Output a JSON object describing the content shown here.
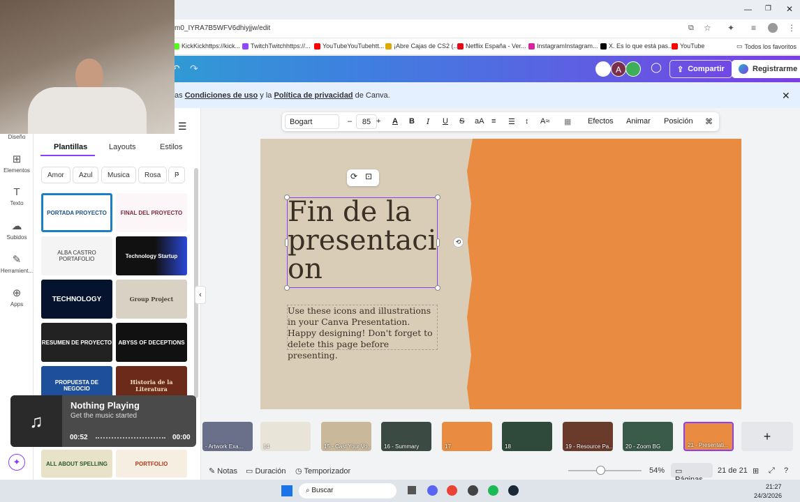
{
  "browser": {
    "url": "m0_IYRA7B5WFV6dhiyjjw/edit",
    "bookmarks": [
      {
        "label": "KickKickhttps://kick...",
        "color": "#53fc18"
      },
      {
        "label": "TwitchTwitchhttps://...",
        "color": "#9146ff"
      },
      {
        "label": "YouTubeYouTubehtt...",
        "color": "#ff0000"
      },
      {
        "label": "¡Abre Cajas de CS2 (...",
        "color": "#e0a800"
      },
      {
        "label": "Netflix España - Ver...",
        "color": "#e50914"
      },
      {
        "label": "InstagramInstagram...",
        "color": "#d6249f"
      },
      {
        "label": "X. Es lo que está pas...",
        "color": "#000000"
      },
      {
        "label": "YouTube",
        "color": "#ff0000"
      }
    ],
    "all_favorites": "Todos los favoritos"
  },
  "header": {
    "avatar_letter": "A",
    "share_label": "Compartir",
    "register_label": "Registrarme"
  },
  "notice": {
    "prefix": "as ",
    "terms": "Condiciones de uso",
    "middle": " y la ",
    "privacy": "Política de privacidad",
    "suffix": " de Canva."
  },
  "rail": [
    {
      "label": "Diseño",
      "icon": "design-icon"
    },
    {
      "label": "Elementos",
      "icon": "elements-icon"
    },
    {
      "label": "Texto",
      "icon": "text-icon"
    },
    {
      "label": "Subidos",
      "icon": "upload-icon"
    },
    {
      "label": "Herramient...",
      "icon": "tools-icon"
    },
    {
      "label": "Apps",
      "icon": "apps-icon"
    }
  ],
  "panel": {
    "tabs": [
      "Plantillas",
      "Layouts",
      "Estilos"
    ],
    "chips": [
      "Amor",
      "Azul",
      "Musica",
      "Rosa",
      "F"
    ],
    "templates": [
      {
        "text": "PORTADA PROYECTO"
      },
      {
        "text": "FINAL DEL PROYECTO"
      },
      {
        "text": "ALBA CASTRO PORTAFOLIO"
      },
      {
        "text": "Technology Startup"
      },
      {
        "text": "TECHNOLOGY"
      },
      {
        "text": "Group Project"
      },
      {
        "text": "RESUMEN DE PROYECTO"
      },
      {
        "text": "ABYSS OF DECEPTIONS"
      },
      {
        "text": "PROPUESTA DE NEGOCIO"
      },
      {
        "text": "Historia de la Literatura"
      },
      {
        "text": "ALL ABOUT SPELLING"
      },
      {
        "text": "PORTFOLIO"
      }
    ]
  },
  "toolbar": {
    "font": "Bogart",
    "size": "85",
    "effects": "Efectos",
    "animate": "Animar",
    "position": "Posición"
  },
  "slide": {
    "title": "Fin de la presentaci on",
    "body": "Use these icons and illustrations in your Canva Presentation. Happy designing! Don't forget to delete this page before presenting."
  },
  "music": {
    "title": "Nothing Playing",
    "subtitle": "Get the music started",
    "elapsed": "00:52",
    "remaining": "00:00"
  },
  "pages": [
    {
      "label": "- Artwork Exa..."
    },
    {
      "label": "14"
    },
    {
      "label": "15 - Cast Your Vo..."
    },
    {
      "label": "16 - Summary"
    },
    {
      "label": "17"
    },
    {
      "label": "18"
    },
    {
      "label": "19 - Resource Pa..."
    },
    {
      "label": "20 - Zoom BG"
    },
    {
      "label": "21 - Presentati..."
    }
  ],
  "footer": {
    "notes": "Notas",
    "duration": "Duración",
    "timer": "Temporizador",
    "zoom": "54%",
    "pages_label": "Páginas",
    "page_count": "21 de 21"
  },
  "taskbar": {
    "search": "Buscar",
    "time": "21:27",
    "date": "24/3/2026"
  }
}
